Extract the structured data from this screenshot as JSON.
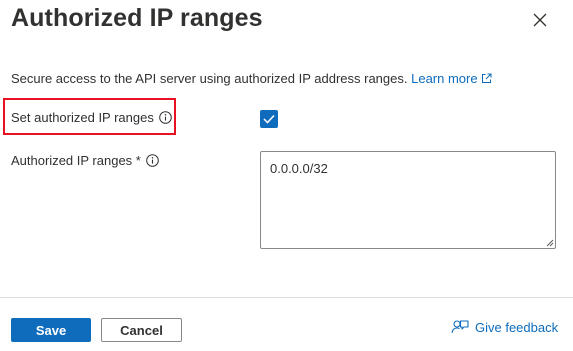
{
  "panel": {
    "title": "Authorized IP ranges",
    "close_icon": "close-icon"
  },
  "description": {
    "text": "Secure access to the API server using authorized IP address ranges.",
    "link_label": "Learn more",
    "link_icon": "external-link-icon"
  },
  "fields": {
    "set_authorized": {
      "label": "Set authorized IP ranges",
      "info_icon": "info-icon",
      "checked": true,
      "highlight_color": "#e81123"
    },
    "authorized_ranges": {
      "label": "Authorized IP ranges *",
      "info_icon": "info-icon",
      "value": "0.0.0.0/32"
    }
  },
  "footer": {
    "save_label": "Save",
    "cancel_label": "Cancel",
    "feedback_label": "Give feedback",
    "feedback_icon": "feedback-icon"
  },
  "colors": {
    "accent": "#0f6cbd",
    "text": "#323130",
    "border": "#8a8886"
  }
}
